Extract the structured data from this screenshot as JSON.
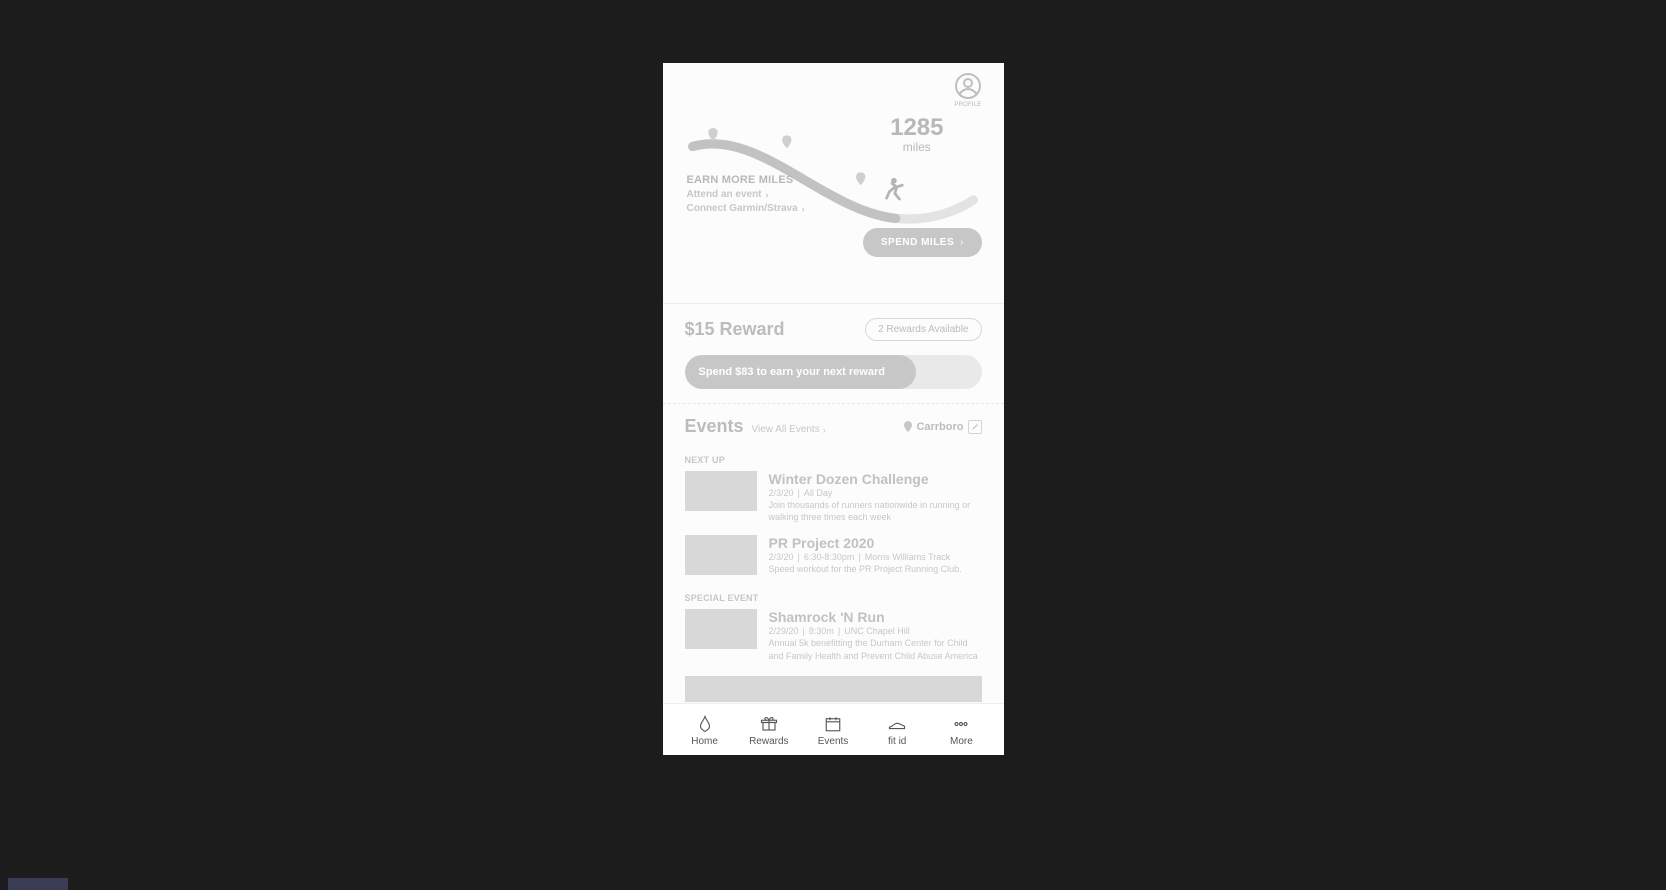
{
  "profile": {
    "label": "PROFILE"
  },
  "miles": {
    "count": "1285",
    "unit": "miles"
  },
  "earn": {
    "title": "EARN MORE MILES",
    "links": [
      "Attend an event",
      "Connect Garmin/Strava"
    ]
  },
  "spend": {
    "label": "SPEND MILES"
  },
  "reward": {
    "title": "$15 Reward",
    "available": "2 Rewards Available",
    "progress_label": "Spend $83 to earn your next reward"
  },
  "events": {
    "title": "Events",
    "view_all": "View All Events",
    "location": "Carrboro",
    "next_up_label": "NEXT UP",
    "special_label": "SPECIAL EVENT",
    "next_up": [
      {
        "name": "Winter Dozen Challenge",
        "date": "2/3/20",
        "time": "All Day",
        "place": "",
        "desc": "Join thousands of runners nationwide in running or walking three times each week"
      },
      {
        "name": "PR Project 2020",
        "date": "2/3/20",
        "time": "6:30-8:30pm",
        "place": "Morris Williams Track",
        "desc": "Speed workout for the PR Project Running Club."
      }
    ],
    "special": [
      {
        "name": "Shamrock 'N Run",
        "date": "2/29/20",
        "time": "8:30m",
        "place": "UNC Chapel Hill",
        "desc": "Annual 5k benefitting the Durham Center for Child and Family Health and Prevent Child Abuse America"
      }
    ]
  },
  "tabs": {
    "home": "Home",
    "rewards": "Rewards",
    "events": "Events",
    "fit": "fit id",
    "more": "More"
  }
}
